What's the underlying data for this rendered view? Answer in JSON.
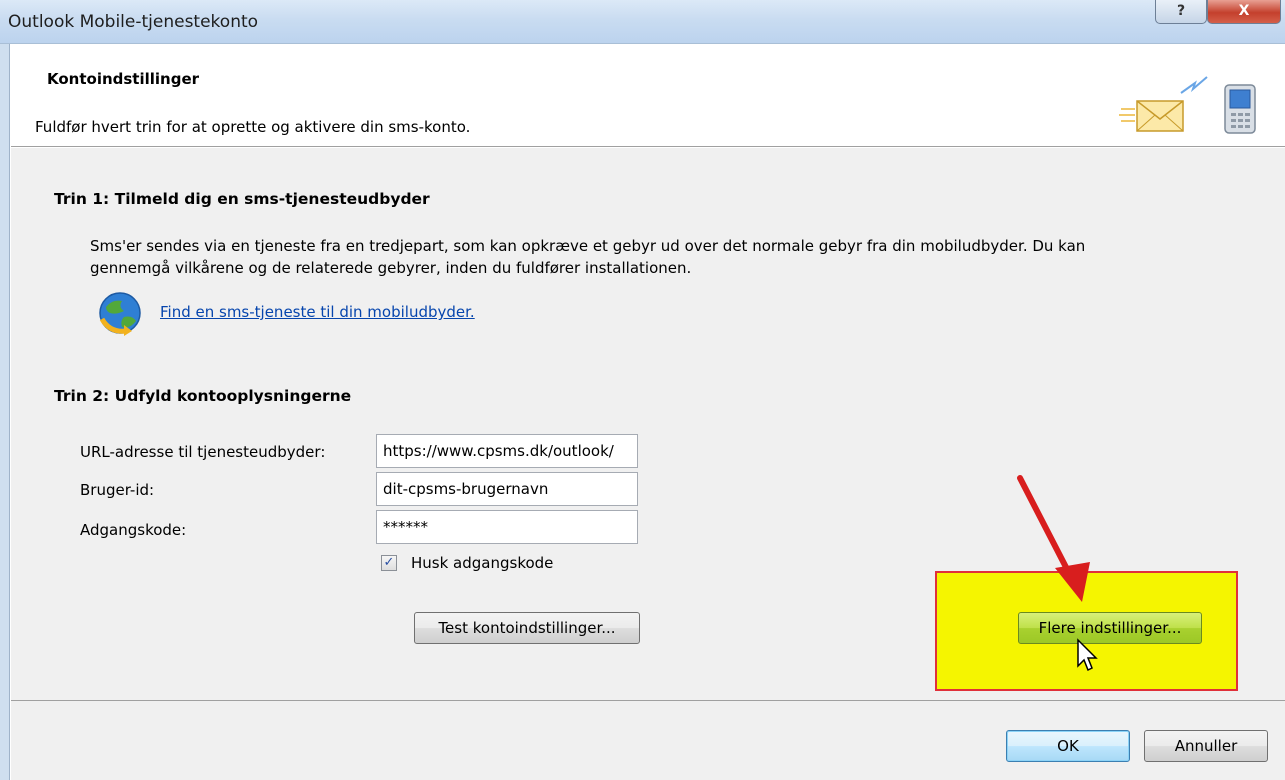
{
  "window": {
    "title": "Outlook Mobile-tjenestekonto",
    "help_glyph": "?",
    "close_glyph": "X"
  },
  "header": {
    "title": "Kontoindstillinger",
    "subtitle": "Fuldfør hvert trin for at oprette og aktivere din sms-konto."
  },
  "step1": {
    "title": "Trin 1: Tilmeld dig en sms-tjenesteudbyder",
    "description_line1": "Sms'er sendes via en tjeneste fra en tredjepart, som kan opkræve et gebyr ud over det normale gebyr fra din mobiludbyder. Du kan",
    "description_line2": "gennemgå vilkårene og de relaterede gebyrer, inden du fuldfører installationen.",
    "link_label": "Find en sms-tjeneste til din mobiludbyder."
  },
  "step2": {
    "title": "Trin 2: Udfyld kontooplysningerne",
    "url_label": "URL-adresse til tjenesteudbyder:",
    "url_value": "https://www.cpsms.dk/outlook/",
    "user_label": "Bruger-id:",
    "user_value": "dit-cpsms-brugernavn",
    "password_label": "Adgangskode:",
    "password_value": "******",
    "remember_label": "Husk adgangskode",
    "remember_checked": true,
    "test_button": "Test kontoindstillinger...",
    "more_button": "Flere indstillinger..."
  },
  "footer": {
    "ok_button": "OK",
    "cancel_button": "Annuller"
  },
  "colors": {
    "highlight_fill": "#f5f500",
    "highlight_border": "#e0303a",
    "arrow": "#d81e1e",
    "link": "#0645ad"
  }
}
